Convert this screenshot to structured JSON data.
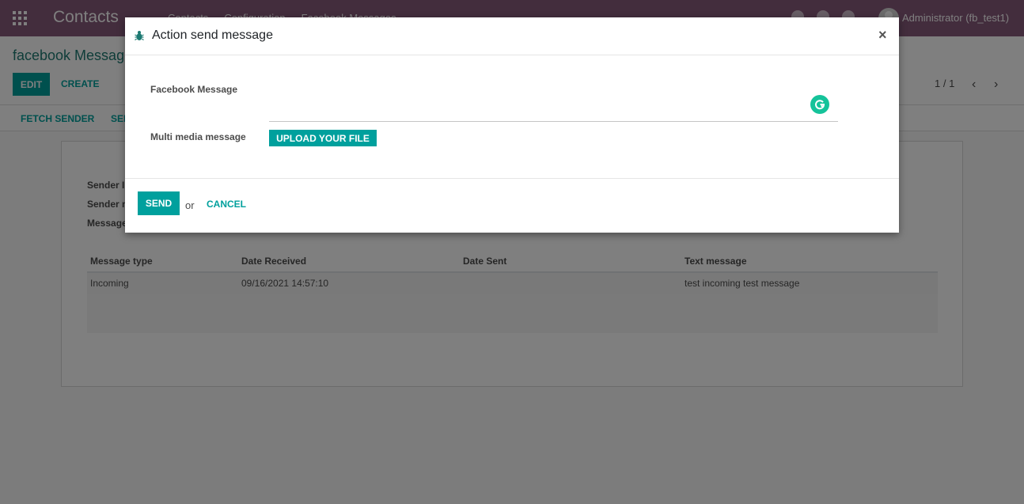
{
  "topbar": {
    "app_title": "Contacts",
    "menu": [
      "Contacts",
      "Configuration",
      "Facebook Messages"
    ],
    "user_name": "Administrator (fb_test1)"
  },
  "control_panel": {
    "breadcrumb": "facebook Message",
    "edit_label": "EDIT",
    "create_label": "CREATE",
    "pager": "1 / 1",
    "prev_icon": "‹",
    "next_icon": "›"
  },
  "statusbar": {
    "fetch_sender_label": "FETCH SENDER",
    "send_label": "SEND MESSAGE"
  },
  "sheet": {
    "fields": [
      "Sender ID",
      "Sender name",
      "Message"
    ],
    "table": {
      "headers": [
        "Message type",
        "Date Received",
        "Date Sent",
        "Text message"
      ],
      "rows": [
        [
          "Incoming",
          "09/16/2021 14:57:10",
          "",
          "test incoming test message"
        ]
      ]
    }
  },
  "modal": {
    "title": "Action send message",
    "close_icon": "×",
    "fb_message_label": "Facebook Message",
    "fb_message_value": "",
    "multimedia_label": "Multi media message",
    "upload_label": "UPLOAD YOUR FILE",
    "send_label": "SEND",
    "or_text": "or",
    "cancel_label": "CANCEL"
  },
  "colors": {
    "topbar": "#875a7b",
    "accent": "#00a09d",
    "grammarly": "#15c39a"
  }
}
